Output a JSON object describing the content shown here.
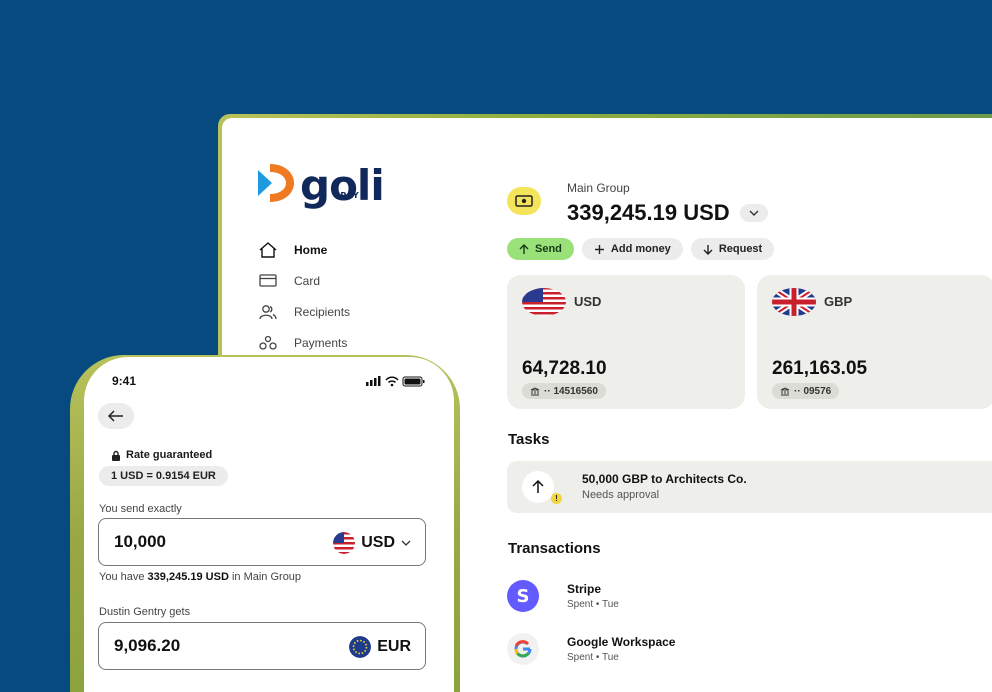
{
  "brand": {
    "name": "goli",
    "sub": "PAY"
  },
  "nav": [
    {
      "label": "Home",
      "icon": "home-icon",
      "active": true
    },
    {
      "label": "Card",
      "icon": "card-icon",
      "active": false
    },
    {
      "label": "Recipients",
      "icon": "recipients-icon",
      "active": false
    },
    {
      "label": "Payments",
      "icon": "payments-icon",
      "active": false
    }
  ],
  "balance": {
    "group": "Main Group",
    "amount": "339,245.19 USD"
  },
  "actions": {
    "send": "Send",
    "add": "Add money",
    "request": "Request"
  },
  "accounts": [
    {
      "currency": "USD",
      "amount": "64,728.10",
      "number": "·· 14516560"
    },
    {
      "currency": "GBP",
      "amount": "261,163.05",
      "number": "·· 09576"
    }
  ],
  "tasks": {
    "heading": "Tasks",
    "item": {
      "title": "50,000 GBP to Architects Co.",
      "status": "Needs approval"
    }
  },
  "transactions": {
    "heading": "Transactions",
    "items": [
      {
        "name": "Stripe",
        "sub": "Spent • Tue"
      },
      {
        "name": "Google Workspace",
        "sub": "Spent • Tue"
      }
    ]
  },
  "phone": {
    "time": "9:41",
    "rate_label": "Rate guaranteed",
    "rate": "1 USD = 0.9154 EUR",
    "send_label": "You send exactly",
    "send_value": "10,000",
    "send_currency": "USD",
    "have_prefix": "You have",
    "have_amount": "339,245.19 USD",
    "have_suffix": "in Main Group",
    "gets_label": "Dustin Gentry gets",
    "gets_value": "9,096.20",
    "gets_currency": "EUR"
  },
  "colors": {
    "background": "#074a80",
    "accent_green": "#9be17a",
    "accent_yellow": "#f4e45b"
  }
}
